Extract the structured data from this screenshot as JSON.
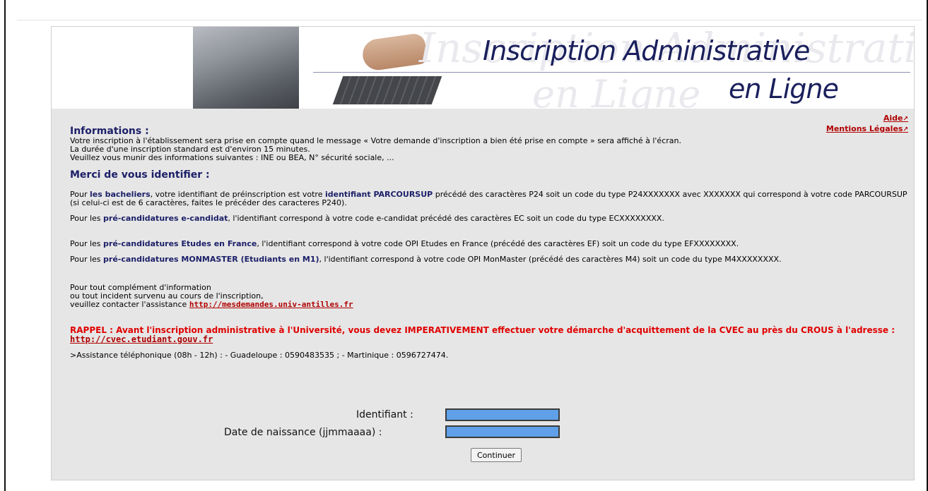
{
  "banner": {
    "title_line1": "Inscription Administrative",
    "title_line2": "en Ligne"
  },
  "links": {
    "aide": "Aide",
    "mentions": "Mentions Légales",
    "arrow_icon": "external-link-icon"
  },
  "informations": {
    "heading": "Informations :",
    "line1": "Votre inscription à l'établissement sera prise en compte quand le message « Votre demande d'inscription a bien été prise en compte » sera affiché à l'écran.",
    "line2": "La durée d'une inscription standard est d'environ 15 minutes.",
    "line3": "Veuillez vous munir des informations suivantes : INE ou BEA, N° sécurité sociale, ..."
  },
  "identify": {
    "heading": "Merci de vous identifier :",
    "bacheliers": {
      "prefix": "Pour ",
      "bold1": "les bacheliers",
      "mid": ", votre identifiant de préinscription est votre ",
      "bold2": "identifiant PARCOURSUP",
      "suffix": " précédé des caractères P24 soit un code du type P24XXXXXXX avec XXXXXXX qui correspond à votre code PARCOURSUP (si celui-ci est de 6 caractères, faites le précéder des caracteres P240)."
    },
    "ecandidat": {
      "prefix": "Pour les ",
      "bold": "pré-candidatures e-candidat",
      "suffix": ", l'identifiant correspond à votre code e-candidat précédé des caractères EC soit un code du type ECXXXXXXXX."
    },
    "etudes_france": {
      "prefix": "Pour les ",
      "bold": "pré-candidatures Etudes en France",
      "suffix": ", l'identifiant correspond à votre code OPI Etudes en France (précédé des caractères EF) soit un code du type EFXXXXXXXX."
    },
    "monmaster": {
      "prefix": "Pour les ",
      "bold": "pré-candidatures MONMASTER (Etudiants en M1)",
      "suffix": ", l'identifiant correspond à votre code OPI MonMaster (précédé des caractères M4) soit un code du type M4XXXXXXXX."
    }
  },
  "assistance": {
    "line1": "Pour tout complément d'information",
    "line2": "ou tout incident survenu au cours de l'inscription,",
    "line3": "veuillez contacter l'assistance ",
    "link": "http://mesdemandes.univ-antilles.fr"
  },
  "rappel": {
    "text": "RAPPEL : Avant l'inscription administrative à l'Université, vous devez IMPERATIVEMENT effectuer votre démarche d'acquittement de la CVEC au près du CROUS à l'adresse : ",
    "link": "http://cvec.etudiant.gouv.fr"
  },
  "phone": ">Assistance téléphonique (08h - 12h) : - Guadeloupe : 0590483535 ; - Martinique : 0596727474.",
  "form": {
    "identifiant_label": "Identifiant :",
    "identifiant_value": "",
    "dob_label": "Date de naissance (jjmmaaaa) :",
    "dob_value": "",
    "submit_label": "Continuer"
  },
  "colors": {
    "heading": "#1c2068",
    "link": "#b00000",
    "alert": "#e00000",
    "field_bg": "#5fa0e8",
    "panel_bg": "#e6e6e6"
  }
}
